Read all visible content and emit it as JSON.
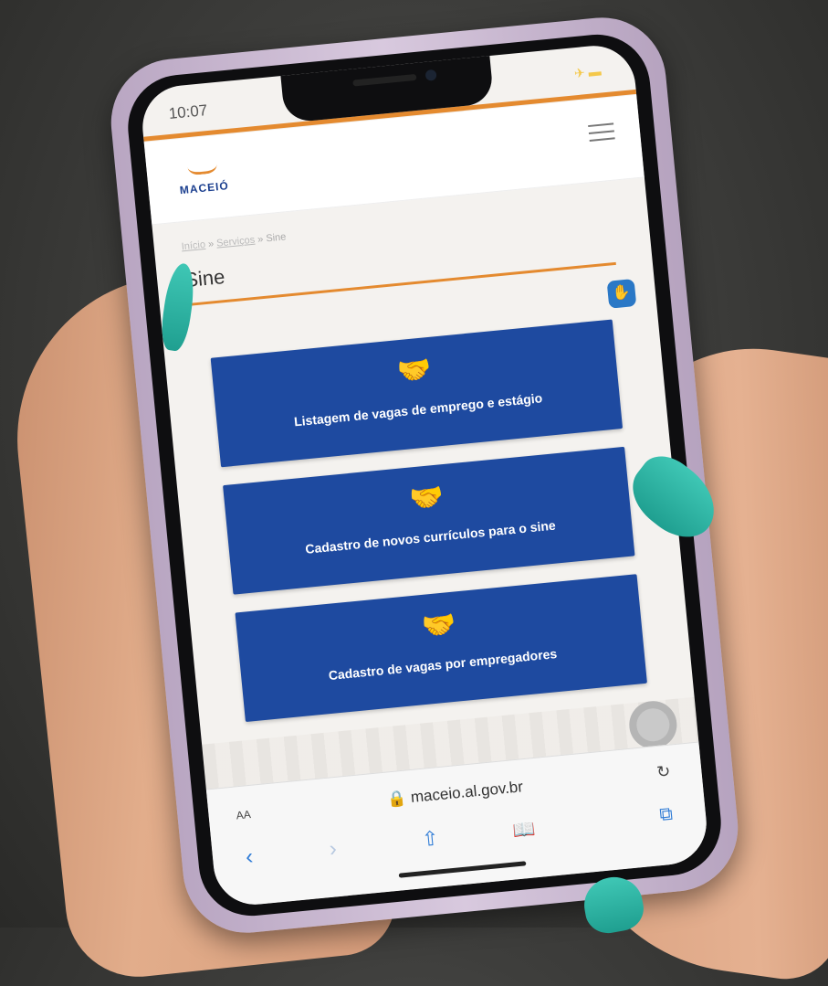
{
  "status_bar": {
    "time": "10:07",
    "icons": "✈ ▬"
  },
  "header": {
    "logo_text": "MACEIÓ",
    "logo_mark": "logo-mark",
    "menu_icon": "hamburger-icon"
  },
  "breadcrumb": {
    "items": [
      "Início",
      "Serviços",
      "Sine"
    ],
    "separator": "»"
  },
  "page": {
    "title": "Sine"
  },
  "cards": [
    {
      "label": "Listagem de vagas de emprego e estágio",
      "icon": "handshake-icon"
    },
    {
      "label": "Cadastro de novos currículos para o sine",
      "icon": "handshake-icon"
    },
    {
      "label": "Cadastro de vagas por empregadores",
      "icon": "handshake-icon"
    }
  ],
  "browser": {
    "aa": "AA",
    "url": "🔒 maceio.al.gov.br",
    "reload": "↻"
  },
  "colors": {
    "brand_blue": "#1e4aa0",
    "accent_orange": "#e48a2f",
    "nail_teal": "#2fb8a6"
  }
}
